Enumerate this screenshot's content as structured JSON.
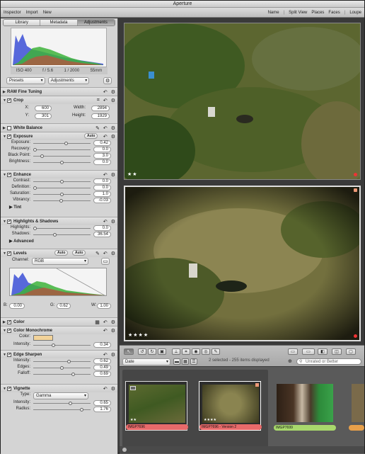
{
  "app_title": "Aperture",
  "toolbar": {
    "left": [
      "Inspector",
      "Import",
      "New"
    ],
    "right": [
      "Name",
      "Split View",
      "Places",
      "Faces",
      "Loupe"
    ]
  },
  "tabs": [
    "Library",
    "Metadata",
    "Adjustments"
  ],
  "exif": [
    "ISO 400",
    "f / 5.6",
    "1 / 2000",
    "55mm"
  ],
  "presets": {
    "presets_label": "Presets",
    "adjustments_label": "Adjustments"
  },
  "raw_fine_tuning": "RAW Fine Tuning",
  "crop": {
    "title": "Crop",
    "x_label": "X:",
    "x": "600",
    "y_label": "Y:",
    "y": "301",
    "width_label": "Width:",
    "width": "2894",
    "height_label": "Height:",
    "height": "1929"
  },
  "white_balance": "White Balance",
  "exposure": {
    "title": "Exposure",
    "auto": "Auto",
    "rows": [
      {
        "label": "Exposure:",
        "value": "0.42"
      },
      {
        "label": "Recovery:",
        "value": "0.0"
      },
      {
        "label": "Black Point:",
        "value": "3.0"
      },
      {
        "label": "Brightness:",
        "value": "0.0"
      }
    ]
  },
  "enhance": {
    "title": "Enhance",
    "rows": [
      {
        "label": "Contrast:",
        "value": "0.0"
      },
      {
        "label": "Definition:",
        "value": "0.0"
      },
      {
        "label": "Saturation:",
        "value": "1.0"
      },
      {
        "label": "Vibrancy:",
        "value": "-0.03"
      }
    ],
    "tint": "Tint"
  },
  "highlights_shadows": {
    "title": "Highlights & Shadows",
    "rows": [
      {
        "label": "Highlights:",
        "value": "0.0"
      },
      {
        "label": "Shadows:",
        "value": "36.54"
      }
    ],
    "advanced": "Advanced"
  },
  "levels": {
    "title": "Levels",
    "auto1": "Auto",
    "auto2": "Auto",
    "channel_label": "Channel:",
    "channel": "RGB",
    "b_label": "B:",
    "b": "0.00",
    "g_label": "G:",
    "g": "0.62",
    "w_label": "W:",
    "w": "1.00"
  },
  "color": "Color",
  "color_mono": {
    "title": "Color Monochrome",
    "color_label": "Color:",
    "intensity_label": "Intensity:",
    "intensity": "0.34",
    "swatch": "#f2d39a"
  },
  "edge_sharpen": {
    "title": "Edge Sharpen",
    "rows": [
      {
        "label": "Intensity:",
        "value": "0.62"
      },
      {
        "label": "Edges:",
        "value": "0.49"
      },
      {
        "label": "Falloff:",
        "value": "0.69"
      }
    ]
  },
  "vignette": {
    "title": "Vignette",
    "type_label": "Type:",
    "type": "Gamma",
    "rows": [
      {
        "label": "Intensity:",
        "value": "0.65"
      },
      {
        "label": "Radius:",
        "value": "1.76"
      }
    ]
  },
  "viewer": {
    "top_stars": "★★",
    "bottom_stars": "★★★★"
  },
  "browser_bar": {
    "sort": "Date",
    "status": "2 selected - 255 items displayed",
    "search": "Unrated or Better"
  },
  "thumbs": [
    {
      "name": "IMGP7696",
      "stars": "★★",
      "color": "#e86a6a"
    },
    {
      "name": "IMGP7696 - Version 2",
      "stars": "★★★★",
      "color": "#e86a6a"
    },
    {
      "name": "IMGP7699",
      "stars": "",
      "color": "#a8d86c"
    }
  ]
}
